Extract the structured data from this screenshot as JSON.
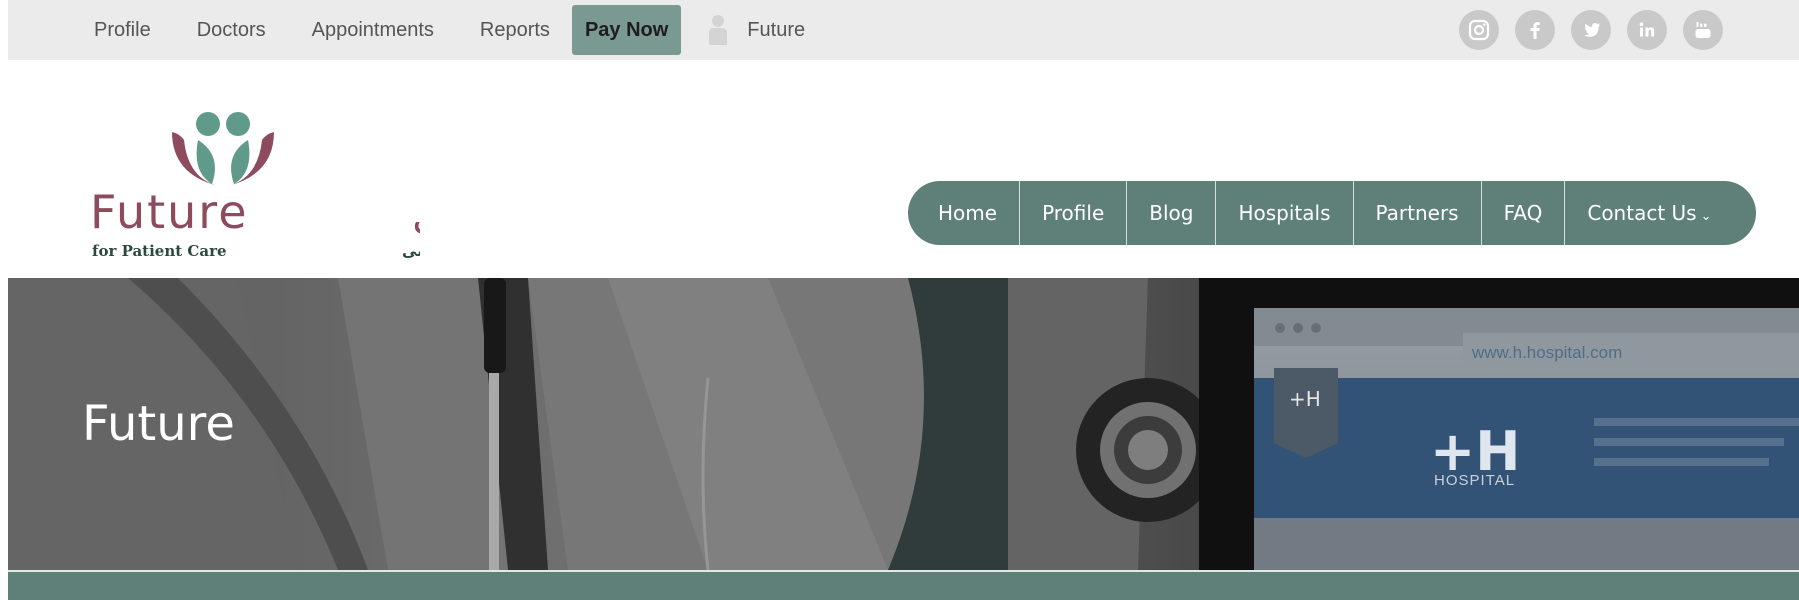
{
  "topbar": {
    "links": [
      "Profile",
      "Doctors",
      "Appointments",
      "Reports"
    ],
    "pay_now": "Pay Now",
    "user_label": "Future",
    "socials": [
      "instagram-icon",
      "facebook-icon",
      "twitter-icon",
      "linkedin-icon",
      "youtube-icon"
    ]
  },
  "logo": {
    "brand_latin": "Future",
    "brand_arabic": "المستقبل",
    "tagline_latin": "for Patient Care",
    "tagline_arabic": "للعناية بالمرضى"
  },
  "nav": {
    "items": [
      "Home",
      "Profile",
      "Blog",
      "Hospitals",
      "Partners",
      "FAQ",
      "Contact Us"
    ]
  },
  "hero": {
    "title": "Future",
    "screen_url": "www.h.hospital.com",
    "screen_brand": "+H",
    "screen_sub": "HOSPITAL",
    "tile_mark": "+H"
  },
  "colors": {
    "accent": "#5f7f79",
    "pay_now_bg": "#7a9993",
    "logo_maroon": "#8e4b5e",
    "logo_green": "#2b4a3c",
    "logo_teal": "#5f9a8a"
  }
}
